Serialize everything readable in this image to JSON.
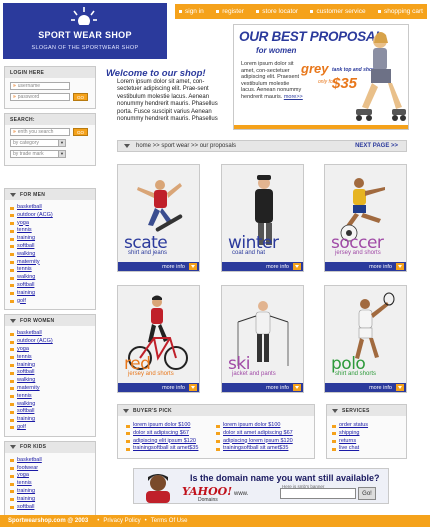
{
  "header": {
    "logo_title": "SPORT WEAR SHOP",
    "slogan": "SLOGAN OF THE SPORTWEAR SHOP"
  },
  "topnav": [
    "sign in",
    "register",
    "store locator",
    "customer service",
    "shopping cart"
  ],
  "promo": {
    "title": "OUR BEST PROPOSAL",
    "subtitle": "for women",
    "text": "Lorem ipsum dolor sit amet, con-sectetuer adipiscing elit. Praesent vestibulum molestie lacus. Aenean nonummy hendrerit mauris.",
    "more": "more>>",
    "grey": "grey",
    "tag": "tank top and shorts",
    "only_for": "only for",
    "price": "$35"
  },
  "login": {
    "heading": "LOGIN HERE",
    "username_placeholder": "username",
    "password_placeholder": "password",
    "go_label": "GO"
  },
  "search": {
    "heading": "SEARCH:",
    "placeholder": "enth you search",
    "go_label": "GO",
    "category_label": "by category",
    "trademark_label": "by trade mark"
  },
  "men": {
    "heading": "FOR MEN",
    "items": [
      "basketball",
      "outdoor (ACG)",
      "yoga",
      "tennis",
      "training",
      "softball",
      "walking",
      "maternity",
      "tennis",
      "walking",
      "softball",
      "training",
      "golf"
    ]
  },
  "women": {
    "heading": "FOR WOMEN",
    "items": [
      "basketball",
      "outdoor (ACG)",
      "yoga",
      "tennis",
      "training",
      "softball",
      "walking",
      "maternity",
      "tennis",
      "walking",
      "softball",
      "training",
      "golf"
    ]
  },
  "kids": {
    "heading": "FOR KIDS",
    "items": [
      "basketball",
      "footwear",
      "yoga",
      "tennis",
      "training",
      "training",
      "softball"
    ]
  },
  "welcome": {
    "title": "Welcome to our shop!",
    "text": "Lorem ipsum dolor sit amet, con-sectetuer adipiscing elit. Prae-sent vestibulum molestie lacus. Aenean nonummy hendrerit mauris. Phasellus porta. Fusce suscipit varius Aenean nonummy hendrerit mauris. Phasellus"
  },
  "breadcrumb": {
    "path": "home >> sport wear >> our proposals",
    "next": "NEXT PAGE >>"
  },
  "products": [
    {
      "name": "scate",
      "desc": "shirt and jeans",
      "more": "more info",
      "color": "#2b3a9c"
    },
    {
      "name": "winter",
      "desc": "coat and hat",
      "more": "more info",
      "color": "#2b3a9c"
    },
    {
      "name": "soccer",
      "desc": "jersey and shorts",
      "more": "more info",
      "color": "#a04aa6"
    },
    {
      "name": "red",
      "desc": "jersey and shorts",
      "more": "more info",
      "color": "#e8771b"
    },
    {
      "name": "ski",
      "desc": "jacket and pants",
      "more": "more info",
      "color": "#a04aa6"
    },
    {
      "name": "polo",
      "desc": "shirt and shorts",
      "more": "more info",
      "color": "#2e9a3b"
    }
  ],
  "buyers_pick": {
    "heading": "BUYER'S PICK",
    "col1": [
      "lorem ipsum dolor $100",
      "dolor sit adipiscing $67",
      "adipiscing elit ipsum $120",
      "trainingsoftball sit amet$35"
    ],
    "col2": [
      "lorem ipsum dolor $100",
      "dolor sit amet adipiscing $67",
      "adipiscing lorem ipsum $120",
      "trainingsoftball sit amet$35"
    ]
  },
  "services": {
    "heading": "SERVICES",
    "items": [
      "order status",
      "shipping",
      "returns",
      "live chat"
    ]
  },
  "ad": {
    "headline": "Is the domain name you want still available?",
    "brand": "YAHOO!",
    "brand_sub": "Domains",
    "note": "Here is smb's banner",
    "www": "www.",
    "go": "Go!"
  },
  "footer": {
    "copyright": "Sportwearshop.com @ 2003",
    "privacy": "Privacy Policy",
    "terms": "Terms Of Use"
  },
  "colors": {
    "brand_blue": "#2b3a9c",
    "accent_orange": "#f5a21b"
  }
}
